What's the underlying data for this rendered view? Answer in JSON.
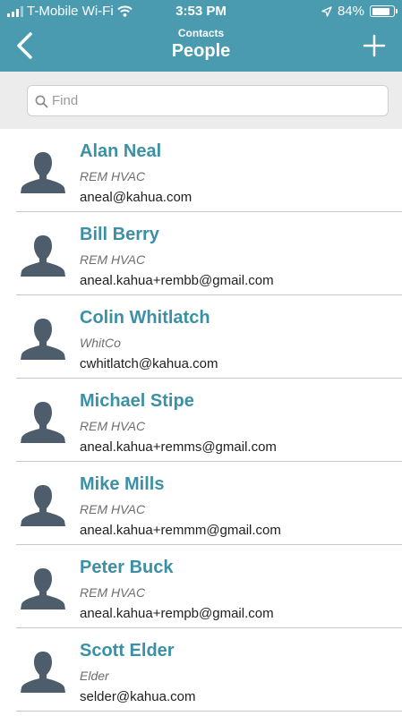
{
  "status_bar": {
    "carrier": "T-Mobile Wi-Fi",
    "time": "3:53 PM",
    "battery": "84%",
    "battery_level": 0.84
  },
  "nav": {
    "subtitle": "Contacts",
    "title": "People",
    "back_icon": "chevron-left-icon",
    "add_icon": "plus-icon"
  },
  "search": {
    "placeholder": "Find",
    "value": ""
  },
  "contacts": [
    {
      "name": "Alan Neal",
      "company": "REM HVAC",
      "email": "aneal@kahua.com"
    },
    {
      "name": "Bill Berry",
      "company": "REM HVAC",
      "email": "aneal.kahua+rembb@gmail.com"
    },
    {
      "name": "Colin Whitlatch",
      "company": "WhitCo",
      "email": "cwhitlatch@kahua.com"
    },
    {
      "name": "Michael Stipe",
      "company": "REM HVAC",
      "email": "aneal.kahua+remms@gmail.com"
    },
    {
      "name": "Mike Mills",
      "company": "REM HVAC",
      "email": "aneal.kahua+remmm@gmail.com"
    },
    {
      "name": "Peter Buck",
      "company": "REM HVAC",
      "email": "aneal.kahua+rempb@gmail.com"
    },
    {
      "name": "Scott Elder",
      "company": "Elder",
      "email": "selder@kahua.com"
    }
  ],
  "colors": {
    "header": "#4a9bb0",
    "accent_name": "#3c90a6",
    "avatar": "#4d5d6b"
  }
}
